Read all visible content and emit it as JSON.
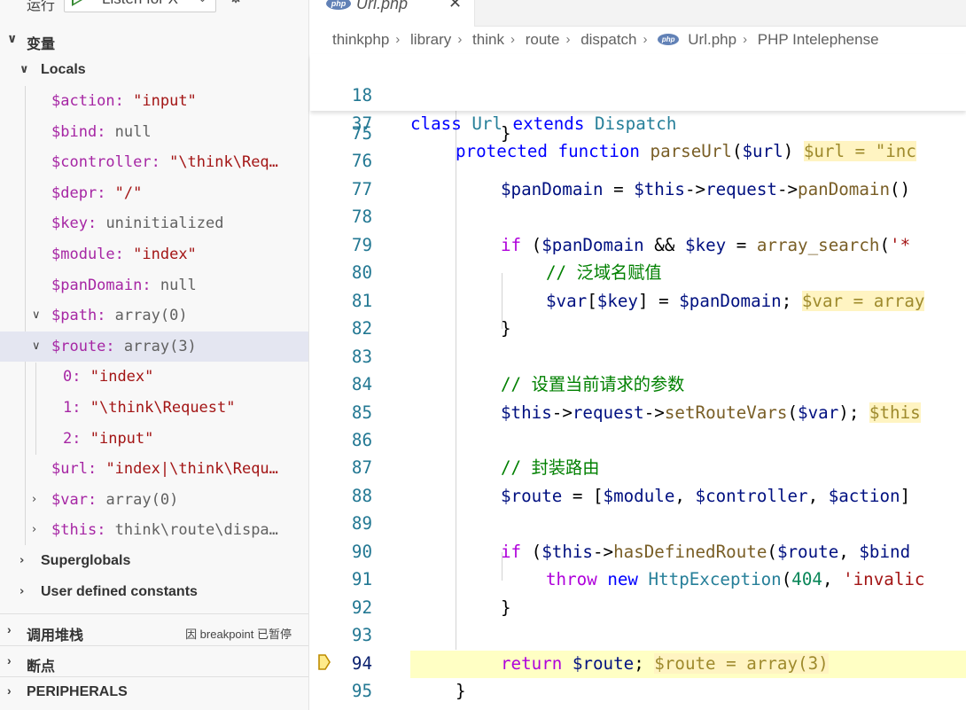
{
  "sidebar": {
    "toolbar": {
      "run_label": "运行",
      "config_label": "Listen for X",
      "settings_icon": "gear-icon",
      "more_icon": "more-icon"
    },
    "variables_header": "变量",
    "locals_label": "Locals",
    "locals": [
      {
        "name": "$action",
        "value": "\"input\"",
        "kind": "string"
      },
      {
        "name": "$bind",
        "value": "null",
        "kind": "plain"
      },
      {
        "name": "$controller",
        "value": "\"\\think\\Req…",
        "kind": "string"
      },
      {
        "name": "$depr",
        "value": "\"/\"",
        "kind": "string"
      },
      {
        "name": "$key",
        "value": "uninitialized",
        "kind": "plain"
      },
      {
        "name": "$module",
        "value": "\"index\"",
        "kind": "string"
      },
      {
        "name": "$panDomain",
        "value": "null",
        "kind": "plain"
      },
      {
        "name": "$path",
        "value": "array(0)",
        "kind": "plain",
        "expandable": true,
        "expanded": true
      },
      {
        "name": "$route",
        "value": "array(3)",
        "kind": "plain",
        "expandable": true,
        "expanded": true,
        "selected": true
      }
    ],
    "route_children": [
      {
        "name": "0",
        "value": "\"index\""
      },
      {
        "name": "1",
        "value": "\"\\think\\Request\""
      },
      {
        "name": "2",
        "value": "\"input\""
      }
    ],
    "locals_after": [
      {
        "name": "$url",
        "value": "\"index|\\think\\Requ…",
        "kind": "string"
      },
      {
        "name": "$var",
        "value": "array(0)",
        "kind": "plain",
        "expandable": true
      },
      {
        "name": "$this",
        "value": "think\\route\\dispa…",
        "kind": "plain",
        "expandable": true
      }
    ],
    "superglobals_label": "Superglobals",
    "user_constants_label": "User defined constants",
    "callstack_header": "调用堆栈",
    "callstack_status": "因 breakpoint 已暂停",
    "breakpoints_header": "断点",
    "peripherals_header": "PERIPHERALS"
  },
  "editor": {
    "tab": {
      "label": "Url.php",
      "icon": "php-icon"
    },
    "breadcrumb": [
      "thinkphp",
      "library",
      "think",
      "route",
      "dispatch",
      "Url.php",
      "PHP Intelephense"
    ],
    "sticky_lines": [
      {
        "num": "18",
        "code": "class Url extends Dispatch"
      },
      {
        "num": "37",
        "code": "protected function parseUrl($url) $url = \"inc"
      }
    ],
    "lines": [
      {
        "num": "75"
      },
      {
        "num": "76"
      },
      {
        "num": "77"
      },
      {
        "num": "78"
      },
      {
        "num": "79"
      },
      {
        "num": "80"
      },
      {
        "num": "81"
      },
      {
        "num": "82"
      },
      {
        "num": "83"
      },
      {
        "num": "84"
      },
      {
        "num": "85"
      },
      {
        "num": "86"
      },
      {
        "num": "87"
      },
      {
        "num": "88"
      },
      {
        "num": "89"
      },
      {
        "num": "90"
      },
      {
        "num": "91"
      },
      {
        "num": "92"
      },
      {
        "num": "93"
      },
      {
        "num": "94"
      },
      {
        "num": "95"
      }
    ],
    "code_text": {
      "l77": "$panDomain = $this->request->panDomain()",
      "l79a": "if ($panDomain && $key = array_search('*",
      "l80": "// 泛域名赋值",
      "l81": "$var[$key] = $panDomain;",
      "l81_inline": "$var = array",
      "l84": "// 设置当前请求的参数",
      "l85": "$this->request->setRouteVars($var);",
      "l85_inline": "$this",
      "l87": "// 封装路由",
      "l88": "$route = [$module, $controller, $action]",
      "l90": "if ($this->hasDefinedRoute($route, $bind",
      "l91_str": "'invalic",
      "l94_inline": "$route = array(3)"
    },
    "colors": {
      "keyword": "#0000ff",
      "control": "#af00db",
      "variable": "#001080",
      "function": "#795e26",
      "comment": "#008000",
      "exec_highlight": "#ffffc4"
    }
  }
}
